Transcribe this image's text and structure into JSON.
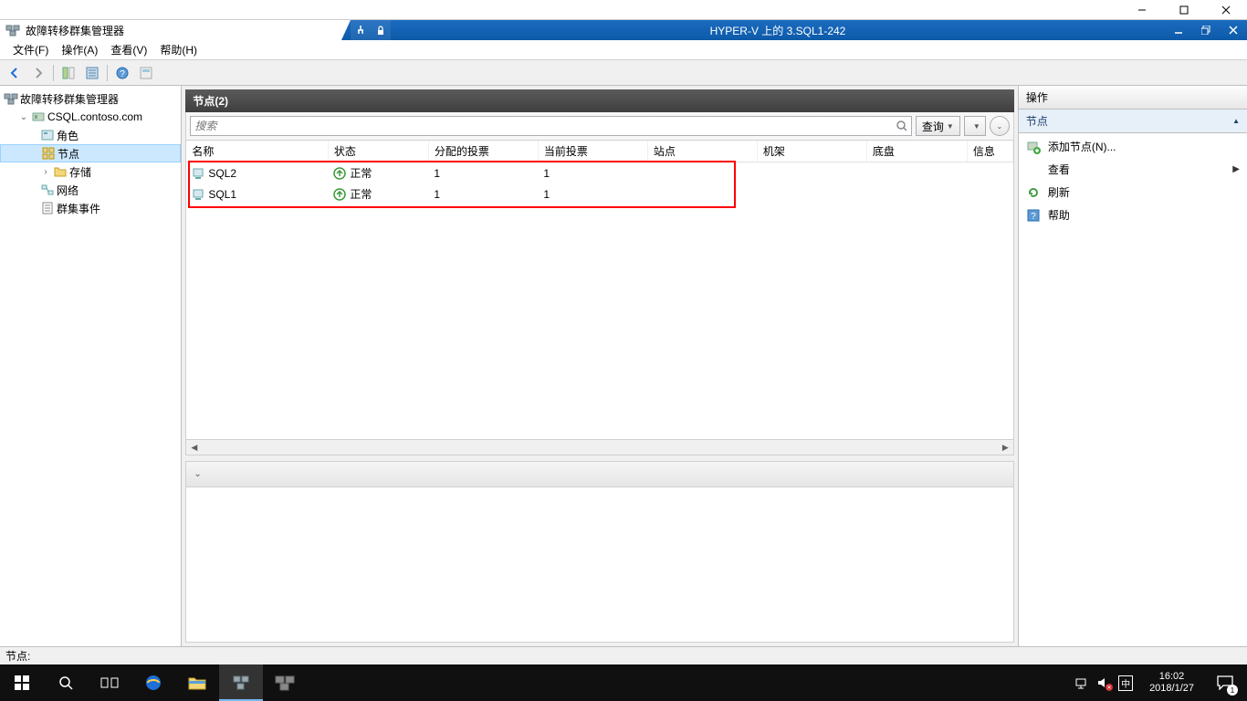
{
  "parent_window": {
    "minimize": "—",
    "maximize": "□",
    "close": "✕"
  },
  "app": {
    "title": "故障转移群集管理器",
    "vm_title": "HYPER-V 上的 3.SQL1-242"
  },
  "menu": {
    "file": "文件(F)",
    "action": "操作(A)",
    "view": "查看(V)",
    "help": "帮助(H)"
  },
  "tree": {
    "root": "故障转移群集管理器",
    "cluster": "CSQL.contoso.com",
    "roles": "角色",
    "nodes": "节点",
    "storage": "存储",
    "network": "网络",
    "events": "群集事件"
  },
  "center": {
    "title": "节点(2)",
    "search_placeholder": "搜索",
    "query_btn": "查询",
    "columns": {
      "name": "名称",
      "status": "状态",
      "assigned": "分配的投票",
      "current": "当前投票",
      "site": "站点",
      "rack": "机架",
      "chassis": "底盘",
      "info": "信息"
    },
    "rows": [
      {
        "name": "SQL2",
        "status": "正常",
        "assigned": "1",
        "current": "1"
      },
      {
        "name": "SQL1",
        "status": "正常",
        "assigned": "1",
        "current": "1"
      }
    ]
  },
  "actions": {
    "title": "操作",
    "section": "节点",
    "add_node": "添加节点(N)...",
    "view": "查看",
    "refresh": "刷新",
    "help": "帮助"
  },
  "statusbar": "节点:",
  "taskbar": {
    "ime": "中",
    "time": "16:02",
    "date": "2018/1/27",
    "badge": "1"
  }
}
